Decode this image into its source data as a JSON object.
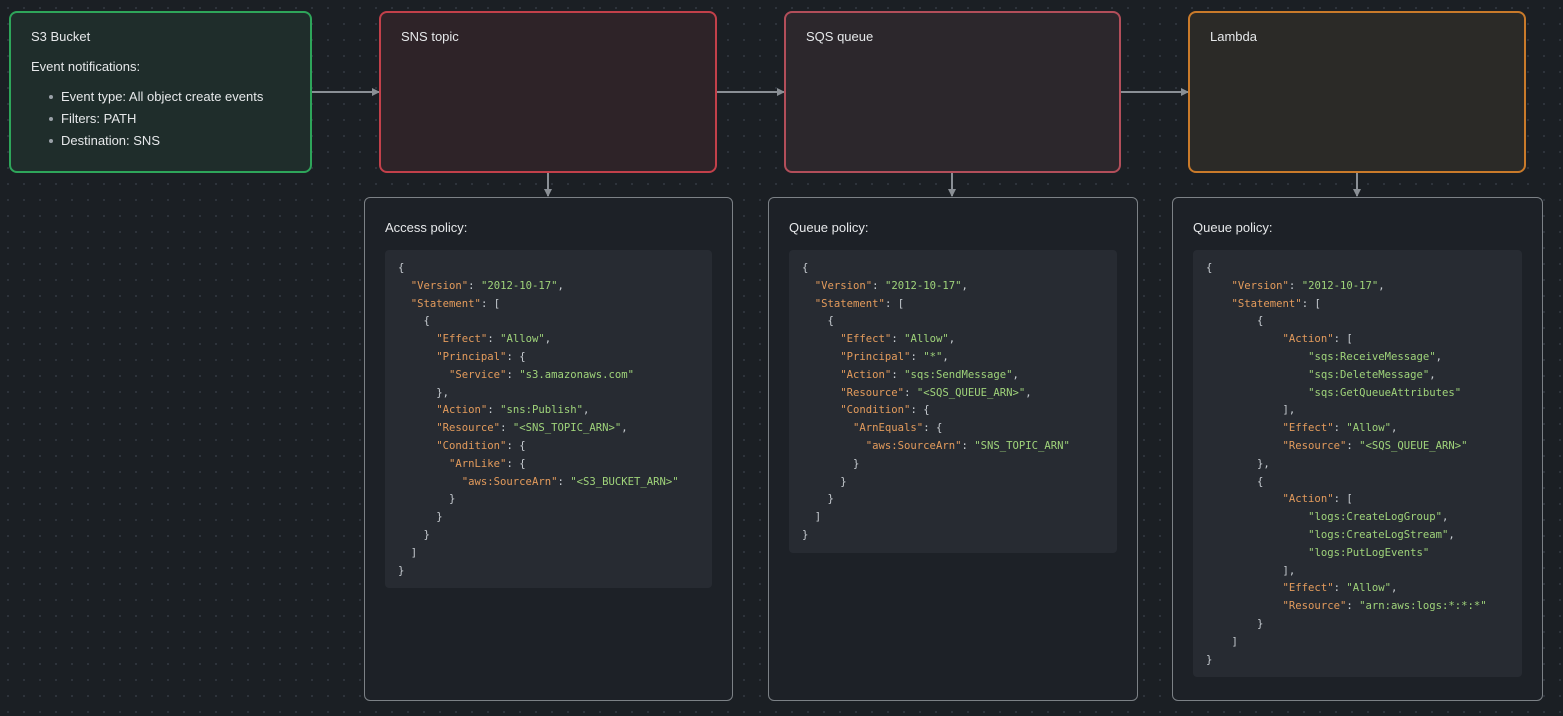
{
  "nodes": {
    "s3": {
      "title": "S3 Bucket",
      "subtitle": "Event notifications:",
      "items": [
        "Event type: All object create events",
        "Filters: PATH",
        "Destination: SNS"
      ]
    },
    "sns": {
      "title": "SNS topic"
    },
    "sqs": {
      "title": "SQS queue"
    },
    "lambda": {
      "title": "Lambda"
    }
  },
  "cards": {
    "sns": {
      "title": "Access policy:",
      "code": "{\n  \"Version\": \"2012-10-17\",\n  \"Statement\": [\n    {\n      \"Effect\": \"Allow\",\n      \"Principal\": {\n        \"Service\": \"s3.amazonaws.com\"\n      },\n      \"Action\": \"sns:Publish\",\n      \"Resource\": \"<SNS_TOPIC_ARN>\",\n      \"Condition\": {\n        \"ArnLike\": {\n          \"aws:SourceArn\": \"<S3_BUCKET_ARN>\"\n        }\n      }\n    }\n  ]\n}"
    },
    "sqs": {
      "title": "Queue policy:",
      "code": "{\n  \"Version\": \"2012-10-17\",\n  \"Statement\": [\n    {\n      \"Effect\": \"Allow\",\n      \"Principal\": \"*\",\n      \"Action\": \"sqs:SendMessage\",\n      \"Resource\": \"<SQS_QUEUE_ARN>\",\n      \"Condition\": {\n        \"ArnEquals\": {\n          \"aws:SourceArn\": \"SNS_TOPIC_ARN\"\n        }\n      }\n    }\n  ]\n}"
    },
    "lambda": {
      "title": "Queue policy:",
      "code": "{\n    \"Version\": \"2012-10-17\",\n    \"Statement\": [\n        {\n            \"Action\": [\n                \"sqs:ReceiveMessage\",\n                \"sqs:DeleteMessage\",\n                \"sqs:GetQueueAttributes\"\n            ],\n            \"Effect\": \"Allow\",\n            \"Resource\": \"<SQS_QUEUE_ARN>\"\n        },\n        {\n            \"Action\": [\n                \"logs:CreateLogGroup\",\n                \"logs:CreateLogStream\",\n                \"logs:PutLogEvents\"\n            ],\n            \"Effect\": \"Allow\",\n            \"Resource\": \"arn:aws:logs:*:*:*\"\n        }\n    ]\n}"
    }
  },
  "colors": {
    "s3_border": "#2ea55a",
    "sns_border": "#c2404a",
    "sqs_border": "#b24e5a",
    "lambda_border": "#c97a2a",
    "json_key": "#e39b5c",
    "json_string": "#9fd37a"
  }
}
